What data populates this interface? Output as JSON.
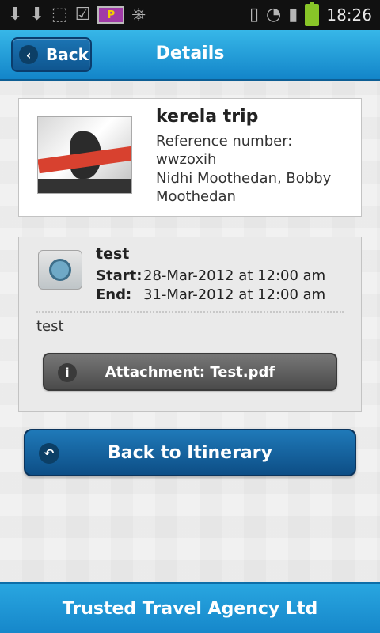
{
  "statusbar": {
    "time": "18:26",
    "icons": [
      "download-icon",
      "download-icon",
      "lock-download-icon",
      "check-icon",
      "p-app-icon",
      "usb-icon",
      "vibrate-icon",
      "wifi-icon",
      "signal-icon",
      "battery-charging-icon"
    ]
  },
  "header": {
    "back_label": "Back",
    "title": "Details"
  },
  "trip": {
    "title": "kerela trip",
    "reference_label": "Reference number:",
    "reference_value": "wwzoxih",
    "travelers": "Nidhi Moothedan, Bobby Moothedan"
  },
  "event": {
    "title": "test",
    "start_label": "Start:",
    "start_value": "28-Mar-2012 at 12:00 am",
    "end_label": "End:",
    "end_value": "31-Mar-2012 at 12:00 am",
    "note": "test",
    "attachment_label": "Attachment: Test.pdf"
  },
  "actions": {
    "back_to_itinerary": "Back to Itinerary"
  },
  "footer": {
    "agency": "Trusted Travel Agency Ltd"
  }
}
